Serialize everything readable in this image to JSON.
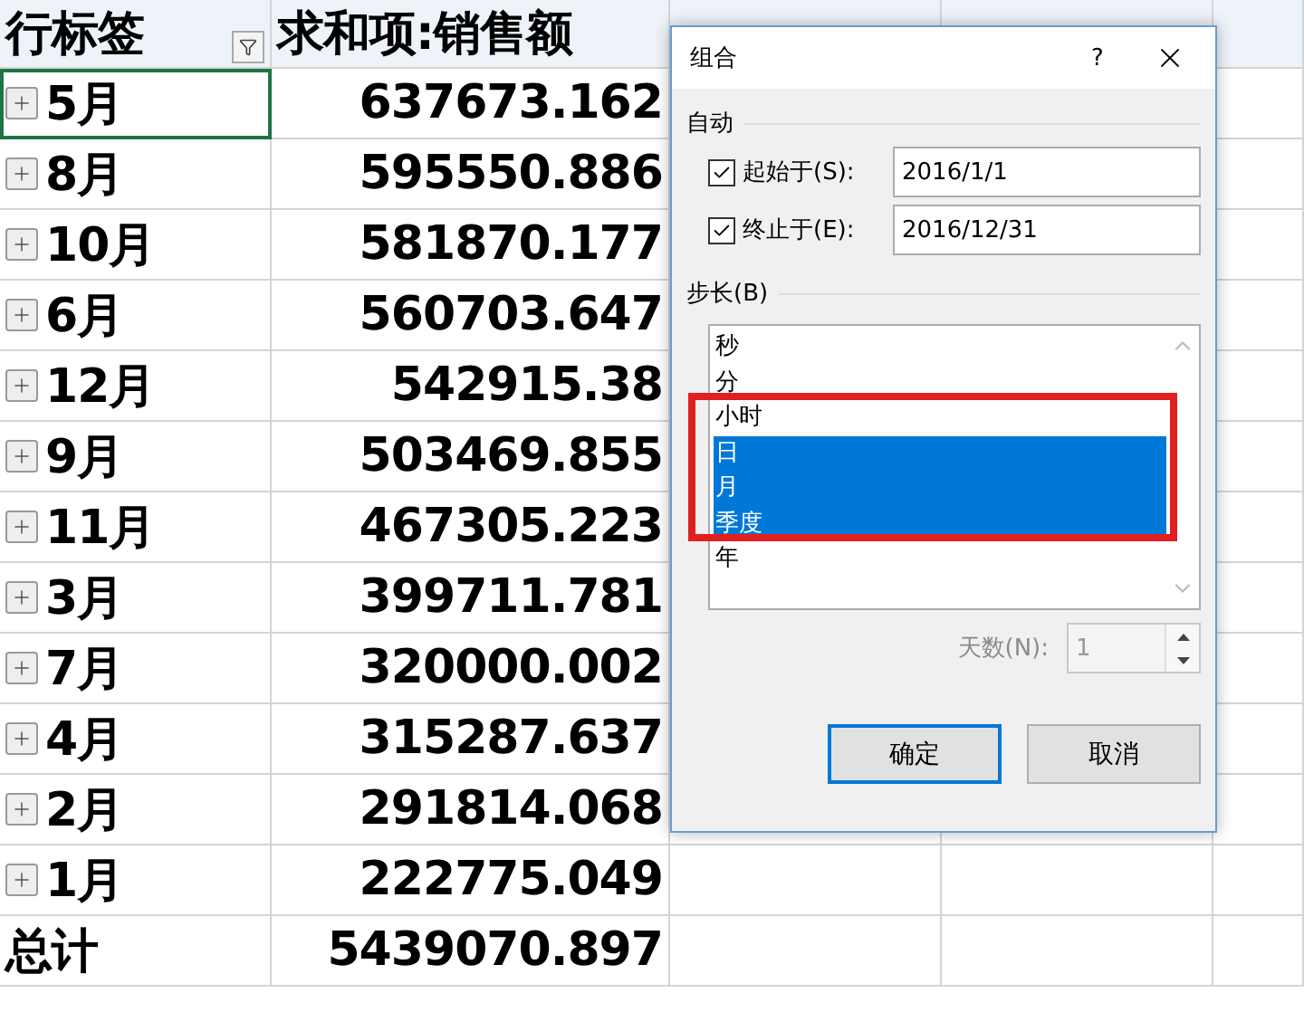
{
  "pivot": {
    "columns": [
      {
        "label": "行标签",
        "filter": true
      },
      {
        "label": "求和项:销售额"
      }
    ],
    "rows": [
      {
        "label": "5月",
        "value": "637673.162",
        "selected": true
      },
      {
        "label": "8月",
        "value": "595550.886",
        "selected": false
      },
      {
        "label": "10月",
        "value": "581870.177",
        "selected": false
      },
      {
        "label": "6月",
        "value": "560703.647",
        "selected": false
      },
      {
        "label": "12月",
        "value": "542915.38",
        "selected": false
      },
      {
        "label": "9月",
        "value": "503469.855",
        "selected": false
      },
      {
        "label": "11月",
        "value": "467305.223",
        "selected": false
      },
      {
        "label": "3月",
        "value": "399711.781",
        "selected": false
      },
      {
        "label": "7月",
        "value": "320000.002",
        "selected": false
      },
      {
        "label": "4月",
        "value": "315287.637",
        "selected": false
      },
      {
        "label": "2月",
        "value": "291814.068",
        "selected": false
      },
      {
        "label": "1月",
        "value": "222775.049",
        "selected": false
      }
    ],
    "total": {
      "label": "总计",
      "value": "5439070.897"
    }
  },
  "dialog": {
    "title": "组合",
    "help": "?",
    "auto_section": "自动",
    "bounds": [
      {
        "label": "起始于(S):",
        "checked": true,
        "value": "2016/1/1"
      },
      {
        "label": "终止于(E):",
        "checked": true,
        "value": "2016/12/31"
      }
    ],
    "by_section": "步长(B)",
    "units": [
      {
        "label": "秒",
        "selected": false
      },
      {
        "label": "分",
        "selected": false
      },
      {
        "label": "小时",
        "selected": false
      },
      {
        "label": "日",
        "selected": true
      },
      {
        "label": "月",
        "selected": true
      },
      {
        "label": "季度",
        "selected": true
      },
      {
        "label": "年",
        "selected": false
      }
    ],
    "days": {
      "label": "天数(N):",
      "value": "1",
      "disabled": true
    },
    "buttons": [
      {
        "label": "确定",
        "default": true
      },
      {
        "label": "取消",
        "default": false
      }
    ]
  }
}
